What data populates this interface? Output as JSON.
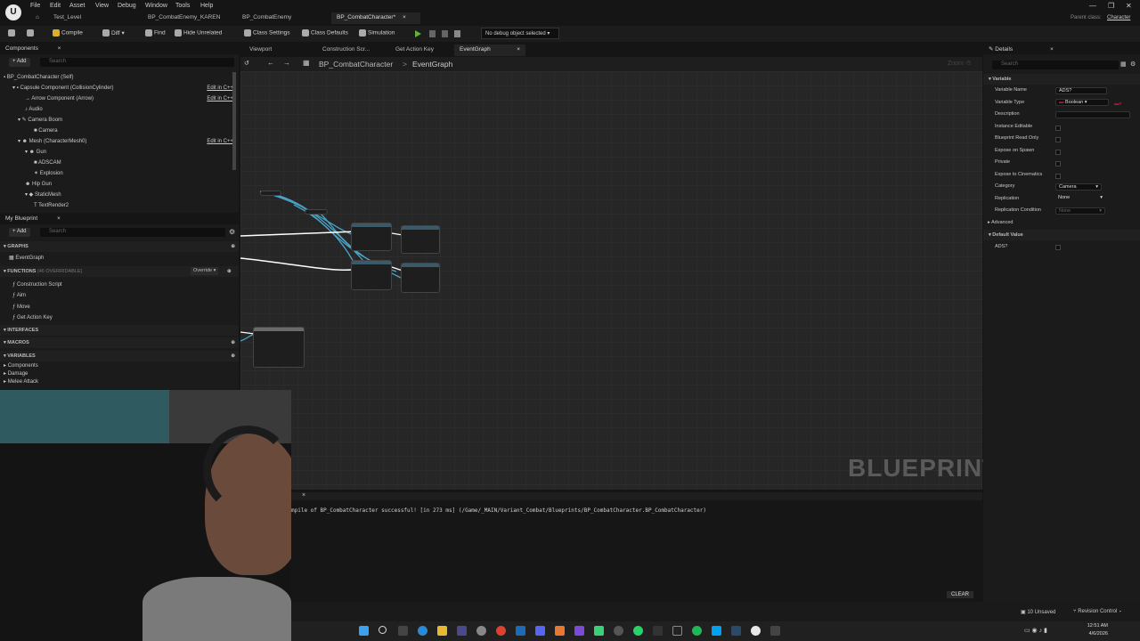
{
  "menu": [
    "File",
    "Edit",
    "Asset",
    "View",
    "Debug",
    "Window",
    "Tools",
    "Help"
  ],
  "tabs": {
    "level": "Test_Level",
    "enemy_karen": "BP_CombatEnemy_KAREN",
    "enemy": "BP_CombatEnemy",
    "character": "BP_CombatCharacter*"
  },
  "parent_class": {
    "label": "Parent class:",
    "value": "Character"
  },
  "toolbar": {
    "compile": "Compile",
    "diff": "Diff",
    "find": "Find",
    "hide_unrelated": "Hide Unrelated",
    "class_settings": "Class Settings",
    "class_defaults": "Class Defaults",
    "simulation": "Simulation",
    "debug_object": "No debug object selected"
  },
  "components": {
    "title": "Components",
    "add": "+ Add",
    "search_placeholder": "Search",
    "items": [
      "BP_CombatCharacter (Self)",
      "Capsule Component (CollisionCylinder)",
      "Arrow Component (Arrow)",
      "Audio",
      "Camera Boom",
      "Camera",
      "Mesh (CharacterMesh0)",
      "Gun",
      "ADSCAM",
      "Explosion",
      "Hip Gun",
      "StaticMesh",
      "TextRender2"
    ],
    "edit_cpp": "Edit in C++"
  },
  "my_blueprint": {
    "title": "My Blueprint",
    "add": "+ Add",
    "search_placeholder": "Search",
    "graphs_label": "GRAPHS",
    "event_graph": "EventGraph",
    "functions_label": "FUNCTIONS",
    "functions_overridable": "(46 OVERRIDABLE)",
    "override": "Override",
    "functions": [
      "Construction Script",
      "Aim",
      "Move",
      "Get Action Key"
    ],
    "interfaces_label": "INTERFACES",
    "macros_label": "MACROS",
    "variables_label": "VARIABLES",
    "variable_groups": [
      "Components",
      "Damage",
      "Melee Attack"
    ]
  },
  "editor_tabs": [
    "Viewport",
    "Construction Scr...",
    "Get Action Key",
    "EventGraph"
  ],
  "breadcrumb": {
    "root": "BP_CombatCharacter",
    "sep": ">",
    "graph": "EventGraph"
  },
  "zoom": "Zoom -5",
  "watermark": "BLUEPRINT",
  "details": {
    "title": "Details",
    "search_placeholder": "Search",
    "variable_section": "Variable",
    "rows": [
      {
        "label": "Variable Name",
        "value": "ADS?"
      },
      {
        "label": "Variable Type",
        "value": "Boolean"
      },
      {
        "label": "Description",
        "value": ""
      },
      {
        "label": "Instance Editable",
        "value": ""
      },
      {
        "label": "Blueprint Read Only",
        "value": ""
      },
      {
        "label": "Expose on Spawn",
        "value": ""
      },
      {
        "label": "Private",
        "value": ""
      },
      {
        "label": "Expose to Cinematics",
        "value": ""
      },
      {
        "label": "Category",
        "value": "Camera"
      },
      {
        "label": "Replication",
        "value": "None"
      },
      {
        "label": "Replication Condition",
        "value": "None"
      }
    ],
    "advanced": "Advanced",
    "default_section": "Default Value",
    "default_row": "ADS?",
    "accent": "#c8102e"
  },
  "log": {
    "message": "mpile of BP_CombatCharacter successful! [in 273 ms] (/Game/_MAIN/Variant_Combat/Blueprints/BP_CombatCharacter.BP_CombatCharacter)",
    "clear": "CLEAR"
  },
  "status": {
    "unsaved": "10 Unsaved",
    "revision": "Revision Control"
  },
  "clock": {
    "time": "12:51 AM",
    "date": "4/6/2026"
  }
}
